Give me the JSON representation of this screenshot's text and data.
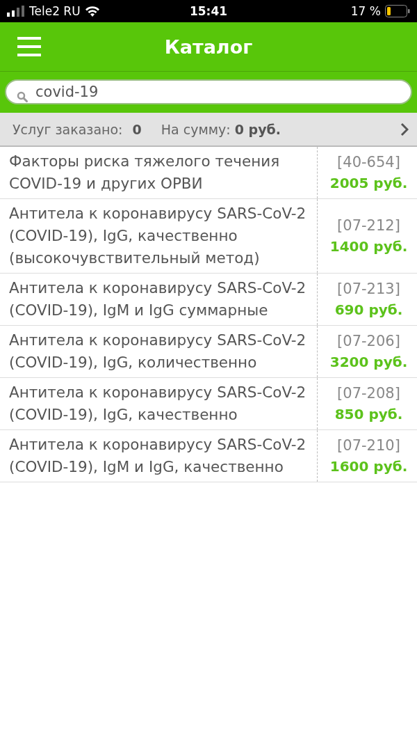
{
  "status_bar": {
    "carrier": "Tele2 RU",
    "time": "15:41",
    "battery": "17 %"
  },
  "header": {
    "title": "Каталог"
  },
  "search": {
    "value": "covid-19"
  },
  "summary": {
    "ordered_label": "Услуг заказано:",
    "ordered_value": "0",
    "sum_label": "На сумму:",
    "sum_value": "0 руб."
  },
  "items": [
    {
      "name": "Факторы риска тяжелого течения COVID-19 и других ОРВИ",
      "code": "[40-654]",
      "price": "2005 руб."
    },
    {
      "name": "Антитела к коронавирусу SARS-CoV-2 (COVID-19), IgG, качественно (высокочувствительный метод)",
      "code": "[07-212]",
      "price": "1400 руб."
    },
    {
      "name": "Антитела к коронавирусу SARS-CoV-2 (COVID-19), IgM и IgG суммарные",
      "code": "[07-213]",
      "price": "690 руб."
    },
    {
      "name": "Антитела к коронавирусу SARS-CoV-2 (COVID-19), IgG, количественно",
      "code": "[07-206]",
      "price": "3200 руб."
    },
    {
      "name": "Антитела к коронавирусу SARS-CoV-2 (COVID-19), IgG, качественно",
      "code": "[07-208]",
      "price": "850 руб."
    },
    {
      "name": "Антитела к коронавирусу SARS-CoV-2 (COVID-19), IgM и IgG, качественно",
      "code": "[07-210]",
      "price": "1600 руб."
    }
  ]
}
